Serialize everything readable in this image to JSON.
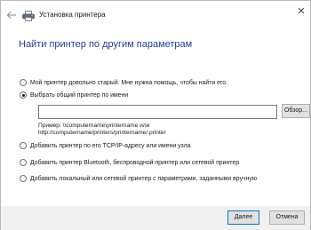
{
  "window": {
    "title": "Установка принтера",
    "back_icon": "back-arrow-icon",
    "app_icon": "printer-icon",
    "close_icon": "close-icon"
  },
  "heading": "Найти принтер по другим параметрам",
  "options": [
    {
      "label": "Мой принтер довольно старый. Мне нужна помощь, чтобы найти его.",
      "selected": false
    },
    {
      "label": "Выбрать общий принтер по имени",
      "selected": true
    },
    {
      "label": "Добавить принтер по его TCP/IP-адресу или имени узла",
      "selected": false
    },
    {
      "label": "Добавить принтер Bluetooth, беспроводной принтер или сетевой принтер",
      "selected": false
    },
    {
      "label": "Добавить локальный или сетевой принтер с параметрами, заданными вручную",
      "selected": false
    }
  ],
  "shared_printer": {
    "value": "",
    "browse_label": "Обзор...",
    "example_line1": "Пример: \\\\computername\\printername или",
    "example_line2": "http://computername/printers/printername/.printer"
  },
  "footer": {
    "next_label": "Далее",
    "cancel_label": "Отмена"
  },
  "colors": {
    "heading": "#1f3f99",
    "footer_bg": "#f0f0f0",
    "button_bg": "#e1e1e1",
    "default_button_border": "#0078d7"
  }
}
